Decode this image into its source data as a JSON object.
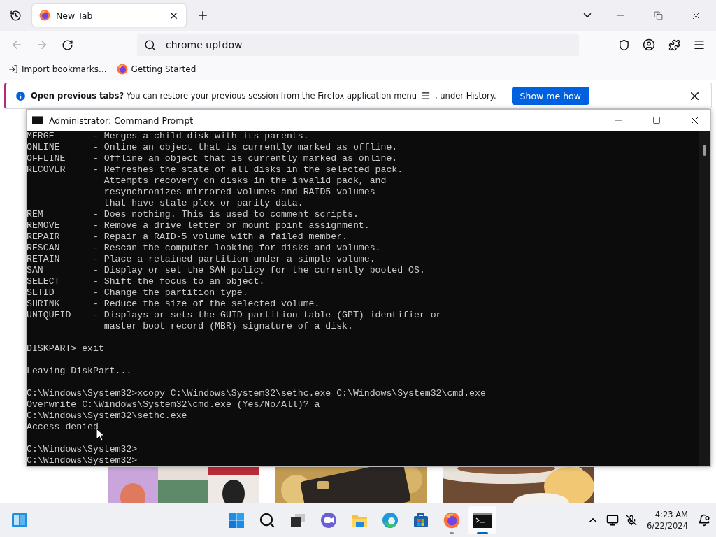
{
  "browser": {
    "tabs": [
      {
        "label": "New Tab",
        "selected": true
      }
    ],
    "address": {
      "value": "chrome uptdow"
    },
    "bookmarks": [
      {
        "label": "Import bookmarks...",
        "kind": "import"
      },
      {
        "label": "Getting Started",
        "kind": "firefox"
      }
    ],
    "notification": {
      "text": "**Open previous tabs?** You can restore your previous session from the Firefox application menu",
      "text_after": ", under History.",
      "button": "Show me how"
    }
  },
  "console_window": {
    "title": "Administrator: Command Prompt",
    "blocks": [
      [
        "MERGE       - Merges a child disk with its parents.",
        "ONLINE      - Online an object that is currently marked as offline.",
        "OFFLINE     - Offline an object that is currently marked as online.",
        "RECOVER     - Refreshes the state of all disks in the selected pack.",
        "              Attempts recovery on disks in the invalid pack, and",
        "              resynchronizes mirrored volumes and RAID5 volumes",
        "              that have stale plex or parity data.",
        "REM         - Does nothing. This is used to comment scripts.",
        "REMOVE      - Remove a drive letter or mount point assignment.",
        "REPAIR      - Repair a RAID-5 volume with a failed member.",
        "RESCAN      - Rescan the computer looking for disks and volumes.",
        "RETAIN      - Place a retained partition under a simple volume.",
        "SAN         - Display or set the SAN policy for the currently booted OS.",
        "SELECT      - Shift the focus to an object.",
        "SETID       - Change the partition type.",
        "SHRINK      - Reduce the size of the selected volume.",
        "UNIQUEID    - Displays or sets the GUID partition table (GPT) identifier or",
        "              master boot record (MBR) signature of a disk."
      ],
      [
        "DISKPART> exit"
      ],
      [
        "Leaving DiskPart..."
      ],
      [
        "C:\\Windows\\System32>xcopy C:\\Windows\\System32\\sethc.exe C:\\Windows\\System32\\cmd.exe",
        "Overwrite C:\\Windows\\System32\\cmd.exe (Yes/No/All)? a",
        "C:\\Windows\\System32\\sethc.exe",
        "Access denied"
      ],
      [
        "C:\\Windows\\System32>",
        "C:\\Windows\\System32>"
      ]
    ]
  },
  "taskbar": {
    "apps": [
      {
        "kind": "windows",
        "running": false,
        "selected": false
      },
      {
        "kind": "search",
        "running": false,
        "selected": false
      },
      {
        "kind": "taskview",
        "running": false,
        "selected": false
      },
      {
        "kind": "chat",
        "running": false,
        "selected": false
      },
      {
        "kind": "explorer",
        "running": false,
        "selected": false
      },
      {
        "kind": "edge",
        "running": false,
        "selected": false
      },
      {
        "kind": "store",
        "running": false,
        "selected": false
      },
      {
        "kind": "firefox",
        "running": true,
        "selected": false
      },
      {
        "kind": "terminal",
        "running": true,
        "selected": true
      }
    ],
    "time": "4:23 AM",
    "date": "6/22/2024"
  }
}
